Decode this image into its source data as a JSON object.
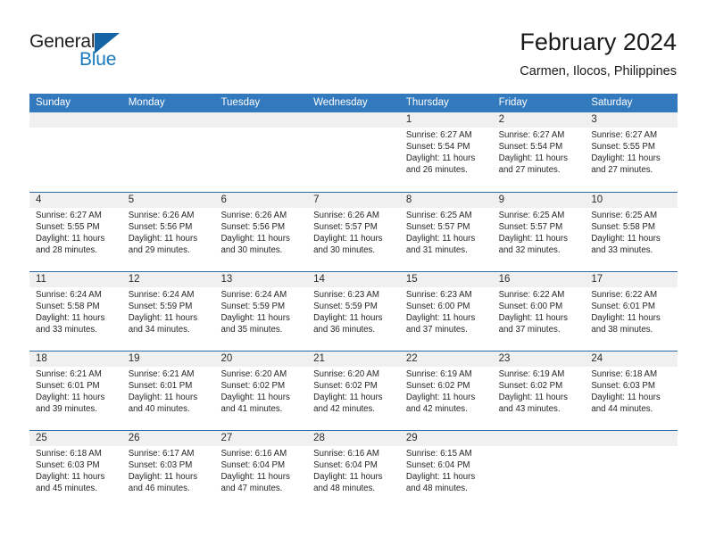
{
  "brand": {
    "name_part1": "General",
    "name_part2": "Blue",
    "logo_icon": "triangle-flag-icon",
    "accent_color": "#1c7ac0"
  },
  "header": {
    "title": "February 2024",
    "subtitle": "Carmen, Ilocos, Philippines"
  },
  "theme": {
    "header_row_bg": "#3279bd",
    "week_separator": "#2b6ca8",
    "day_band_bg": "#f0f0f0"
  },
  "weekdays": [
    "Sunday",
    "Monday",
    "Tuesday",
    "Wednesday",
    "Thursday",
    "Friday",
    "Saturday"
  ],
  "weeks": [
    [
      {
        "day": "",
        "empty": true
      },
      {
        "day": "",
        "empty": true
      },
      {
        "day": "",
        "empty": true
      },
      {
        "day": "",
        "empty": true
      },
      {
        "day": "1",
        "sunrise": "Sunrise: 6:27 AM",
        "sunset": "Sunset: 5:54 PM",
        "daylight1": "Daylight: 11 hours",
        "daylight2": "and 26 minutes."
      },
      {
        "day": "2",
        "sunrise": "Sunrise: 6:27 AM",
        "sunset": "Sunset: 5:54 PM",
        "daylight1": "Daylight: 11 hours",
        "daylight2": "and 27 minutes."
      },
      {
        "day": "3",
        "sunrise": "Sunrise: 6:27 AM",
        "sunset": "Sunset: 5:55 PM",
        "daylight1": "Daylight: 11 hours",
        "daylight2": "and 27 minutes."
      }
    ],
    [
      {
        "day": "4",
        "sunrise": "Sunrise: 6:27 AM",
        "sunset": "Sunset: 5:55 PM",
        "daylight1": "Daylight: 11 hours",
        "daylight2": "and 28 minutes."
      },
      {
        "day": "5",
        "sunrise": "Sunrise: 6:26 AM",
        "sunset": "Sunset: 5:56 PM",
        "daylight1": "Daylight: 11 hours",
        "daylight2": "and 29 minutes."
      },
      {
        "day": "6",
        "sunrise": "Sunrise: 6:26 AM",
        "sunset": "Sunset: 5:56 PM",
        "daylight1": "Daylight: 11 hours",
        "daylight2": "and 30 minutes."
      },
      {
        "day": "7",
        "sunrise": "Sunrise: 6:26 AM",
        "sunset": "Sunset: 5:57 PM",
        "daylight1": "Daylight: 11 hours",
        "daylight2": "and 30 minutes."
      },
      {
        "day": "8",
        "sunrise": "Sunrise: 6:25 AM",
        "sunset": "Sunset: 5:57 PM",
        "daylight1": "Daylight: 11 hours",
        "daylight2": "and 31 minutes."
      },
      {
        "day": "9",
        "sunrise": "Sunrise: 6:25 AM",
        "sunset": "Sunset: 5:57 PM",
        "daylight1": "Daylight: 11 hours",
        "daylight2": "and 32 minutes."
      },
      {
        "day": "10",
        "sunrise": "Sunrise: 6:25 AM",
        "sunset": "Sunset: 5:58 PM",
        "daylight1": "Daylight: 11 hours",
        "daylight2": "and 33 minutes."
      }
    ],
    [
      {
        "day": "11",
        "sunrise": "Sunrise: 6:24 AM",
        "sunset": "Sunset: 5:58 PM",
        "daylight1": "Daylight: 11 hours",
        "daylight2": "and 33 minutes."
      },
      {
        "day": "12",
        "sunrise": "Sunrise: 6:24 AM",
        "sunset": "Sunset: 5:59 PM",
        "daylight1": "Daylight: 11 hours",
        "daylight2": "and 34 minutes."
      },
      {
        "day": "13",
        "sunrise": "Sunrise: 6:24 AM",
        "sunset": "Sunset: 5:59 PM",
        "daylight1": "Daylight: 11 hours",
        "daylight2": "and 35 minutes."
      },
      {
        "day": "14",
        "sunrise": "Sunrise: 6:23 AM",
        "sunset": "Sunset: 5:59 PM",
        "daylight1": "Daylight: 11 hours",
        "daylight2": "and 36 minutes."
      },
      {
        "day": "15",
        "sunrise": "Sunrise: 6:23 AM",
        "sunset": "Sunset: 6:00 PM",
        "daylight1": "Daylight: 11 hours",
        "daylight2": "and 37 minutes."
      },
      {
        "day": "16",
        "sunrise": "Sunrise: 6:22 AM",
        "sunset": "Sunset: 6:00 PM",
        "daylight1": "Daylight: 11 hours",
        "daylight2": "and 37 minutes."
      },
      {
        "day": "17",
        "sunrise": "Sunrise: 6:22 AM",
        "sunset": "Sunset: 6:01 PM",
        "daylight1": "Daylight: 11 hours",
        "daylight2": "and 38 minutes."
      }
    ],
    [
      {
        "day": "18",
        "sunrise": "Sunrise: 6:21 AM",
        "sunset": "Sunset: 6:01 PM",
        "daylight1": "Daylight: 11 hours",
        "daylight2": "and 39 minutes."
      },
      {
        "day": "19",
        "sunrise": "Sunrise: 6:21 AM",
        "sunset": "Sunset: 6:01 PM",
        "daylight1": "Daylight: 11 hours",
        "daylight2": "and 40 minutes."
      },
      {
        "day": "20",
        "sunrise": "Sunrise: 6:20 AM",
        "sunset": "Sunset: 6:02 PM",
        "daylight1": "Daylight: 11 hours",
        "daylight2": "and 41 minutes."
      },
      {
        "day": "21",
        "sunrise": "Sunrise: 6:20 AM",
        "sunset": "Sunset: 6:02 PM",
        "daylight1": "Daylight: 11 hours",
        "daylight2": "and 42 minutes."
      },
      {
        "day": "22",
        "sunrise": "Sunrise: 6:19 AM",
        "sunset": "Sunset: 6:02 PM",
        "daylight1": "Daylight: 11 hours",
        "daylight2": "and 42 minutes."
      },
      {
        "day": "23",
        "sunrise": "Sunrise: 6:19 AM",
        "sunset": "Sunset: 6:02 PM",
        "daylight1": "Daylight: 11 hours",
        "daylight2": "and 43 minutes."
      },
      {
        "day": "24",
        "sunrise": "Sunrise: 6:18 AM",
        "sunset": "Sunset: 6:03 PM",
        "daylight1": "Daylight: 11 hours",
        "daylight2": "and 44 minutes."
      }
    ],
    [
      {
        "day": "25",
        "sunrise": "Sunrise: 6:18 AM",
        "sunset": "Sunset: 6:03 PM",
        "daylight1": "Daylight: 11 hours",
        "daylight2": "and 45 minutes."
      },
      {
        "day": "26",
        "sunrise": "Sunrise: 6:17 AM",
        "sunset": "Sunset: 6:03 PM",
        "daylight1": "Daylight: 11 hours",
        "daylight2": "and 46 minutes."
      },
      {
        "day": "27",
        "sunrise": "Sunrise: 6:16 AM",
        "sunset": "Sunset: 6:04 PM",
        "daylight1": "Daylight: 11 hours",
        "daylight2": "and 47 minutes."
      },
      {
        "day": "28",
        "sunrise": "Sunrise: 6:16 AM",
        "sunset": "Sunset: 6:04 PM",
        "daylight1": "Daylight: 11 hours",
        "daylight2": "and 48 minutes."
      },
      {
        "day": "29",
        "sunrise": "Sunrise: 6:15 AM",
        "sunset": "Sunset: 6:04 PM",
        "daylight1": "Daylight: 11 hours",
        "daylight2": "and 48 minutes."
      },
      {
        "day": "",
        "empty": true
      },
      {
        "day": "",
        "empty": true
      }
    ]
  ]
}
